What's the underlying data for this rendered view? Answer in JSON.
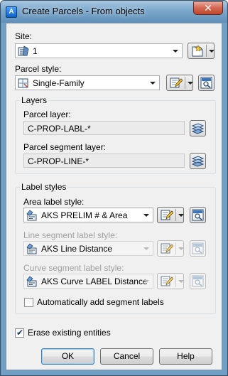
{
  "window": {
    "title": "Create Parcels - From objects",
    "close_glyph": "✕"
  },
  "site": {
    "label": "Site:",
    "value": "1",
    "icon": "site-icon",
    "create_icon": "new-site-icon"
  },
  "parcel_style": {
    "label": "Parcel style:",
    "value": "Single-Family",
    "icon": "parcel-style-icon",
    "edit_icon": "edit-style-icon",
    "view_icon": "preview-icon"
  },
  "layers": {
    "group_title": "Layers",
    "parcel_layer_label": "Parcel layer:",
    "parcel_layer_value": "C-PROP-LABL-*",
    "segment_layer_label": "Parcel segment layer:",
    "segment_layer_value": "C-PROP-LINE-*",
    "layer_icon": "layers-icon"
  },
  "label_styles": {
    "group_title": "Label styles",
    "area_label": "Area label style:",
    "area_value": "AKS PRELIM # & Area",
    "line_label": "Line segment label style:",
    "line_value": "AKS Line Distance",
    "curve_label": "Curve segment label style:",
    "curve_value": "AKS Curve LABEL Distance",
    "auto_add_label": "Automatically add segment labels",
    "auto_add_checked": false,
    "style_icon": "label-style-icon"
  },
  "erase": {
    "label": "Erase existing entities",
    "checked": true,
    "check_glyph": "✔"
  },
  "buttons": {
    "ok": "OK",
    "cancel": "Cancel",
    "help": "Help"
  },
  "colors": {
    "titlebar": "#7ba7cb",
    "close_button": "#c1462b",
    "client_bg": "#f0f0f0",
    "default_button_border": "#3c7fb1"
  }
}
